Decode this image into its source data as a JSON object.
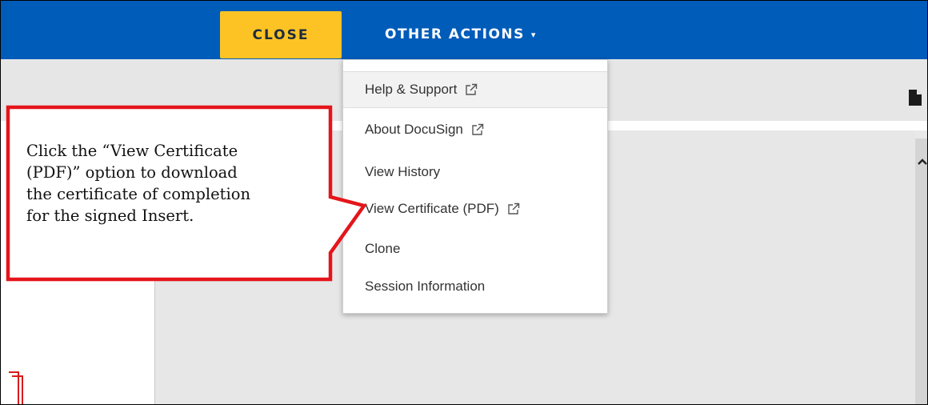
{
  "header": {
    "close_label": "CLOSE",
    "other_actions_label": "OTHER ACTIONS",
    "other_actions_caret": "▾"
  },
  "menu": {
    "items": [
      {
        "label": "Help & Support",
        "external": true,
        "icon": "external-link-icon"
      },
      {
        "label": "About DocuSign",
        "external": true,
        "icon": "external-link-icon"
      },
      {
        "label": "View History",
        "external": false
      },
      {
        "label": "View Certificate (PDF)",
        "external": true,
        "icon": "external-link-icon"
      },
      {
        "label": "Clone",
        "external": false
      },
      {
        "label": "Session Information",
        "external": false
      }
    ]
  },
  "callout": {
    "lines": [
      "Click the “View Certificate",
      "(PDF)” option to download",
      "the certificate of completion",
      "for the signed Insert."
    ]
  },
  "colors": {
    "header_blue": "#005cb9",
    "close_yellow": "#fdc325",
    "callout_red": "#e4151b"
  },
  "icons": {
    "toolbar_right": "document-icon",
    "scroll": "chevron-up-icon"
  }
}
